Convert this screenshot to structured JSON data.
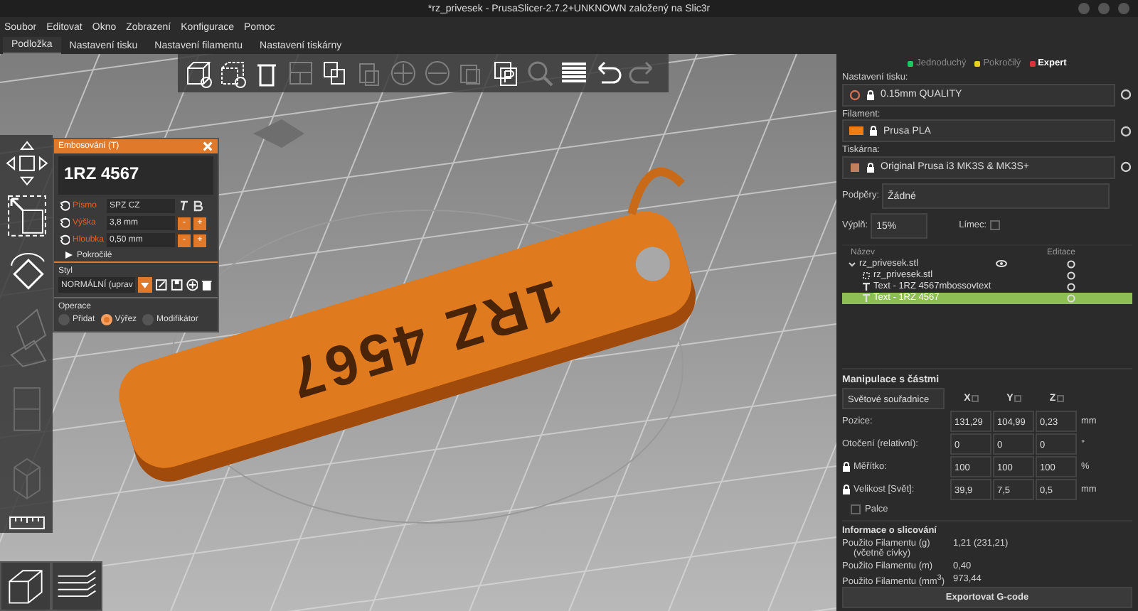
{
  "window": {
    "title": "*rz_privesek - PrusaSlicer-2.7.2+UNKNOWN založený na Slic3r"
  },
  "menu": [
    "Soubor",
    "Editovat",
    "Okno",
    "Zobrazení",
    "Konfigurace",
    "Pomoc"
  ],
  "tabs": [
    {
      "label": "Podložka",
      "selected": true
    },
    {
      "label": "Nastavení tisku",
      "selected": false
    },
    {
      "label": "Nastavení filamentu",
      "selected": false
    },
    {
      "label": "Nastavení tiskárny",
      "selected": false
    }
  ],
  "toolbar": [
    {
      "kind": "add",
      "disabled": false
    },
    {
      "kind": "delete-part",
      "disabled": false
    },
    {
      "kind": "delete",
      "disabled": false
    },
    {
      "kind": "arrange",
      "disabled": true
    },
    {
      "kind": "copy",
      "disabled": false
    },
    {
      "kind": "paste",
      "disabled": true
    },
    {
      "kind": "plus",
      "disabled": true
    },
    {
      "kind": "minus",
      "disabled": true
    },
    {
      "kind": "split",
      "disabled": true
    },
    {
      "kind": "paste-parts",
      "disabled": false
    },
    {
      "kind": "search",
      "disabled": true
    },
    {
      "kind": "layers",
      "disabled": false
    },
    {
      "kind": "undo",
      "disabled": false
    },
    {
      "kind": "redo",
      "disabled": true
    }
  ],
  "viewport": {
    "model_text": "1RZ 4567"
  },
  "emboss": {
    "title": "Embosování (T)",
    "text": "1RZ 4567",
    "fields": [
      {
        "label": "Písmo",
        "value": "SPZ CZ",
        "kind": "font"
      },
      {
        "label": "Výška",
        "value": "3,8 mm",
        "kind": "spin",
        "minus": "-",
        "plus": "+"
      },
      {
        "label": "Hloubka",
        "value": "0,50 mm",
        "kind": "spin",
        "minus": "-",
        "plus": "+"
      }
    ],
    "advanced": {
      "label": "Pokročilé",
      "expanded": false
    },
    "style_label": "Styl",
    "style_value": "NORMÁLNÍ (uprav",
    "operation_label": "Operace",
    "operations": [
      {
        "label": "Přidat",
        "selected": false
      },
      {
        "label": "Výřez",
        "selected": true
      },
      {
        "label": "Modifikátor",
        "selected": false
      }
    ]
  },
  "sidebar": {
    "modes": [
      {
        "label": "Jednoduchý",
        "color": "#22c55e",
        "selected": false
      },
      {
        "label": "Pokročilý",
        "color": "#e8d21e",
        "selected": false
      },
      {
        "label": "Expert",
        "color": "#e0303a",
        "selected": true
      }
    ],
    "presets": [
      {
        "label": "Nastavení tisku:",
        "value": "0.15mm QUALITY",
        "kind": "print"
      },
      {
        "label": "Filament:",
        "value": "Prusa PLA",
        "kind": "filament",
        "color": "#f07c14"
      },
      {
        "label": "Tiskárna:",
        "value": "Original Prusa i3 MK3S & MK3S+",
        "kind": "printer"
      }
    ],
    "supports": {
      "label": "Podpěry:",
      "value": "Žádné"
    },
    "infill": {
      "label": "Výplň:",
      "value": "15%"
    },
    "brim": {
      "label": "Límec:",
      "checked": false
    },
    "object_list": {
      "columns": [
        "Název",
        "Editace"
      ],
      "items": [
        {
          "name": "rz_privesek.stl",
          "kind": "object",
          "expanded": true,
          "selected": false,
          "children": [
            {
              "name": "rz_privesek.stl",
              "kind": "part",
              "selected": false
            },
            {
              "name": "Text - 1RZ 4567mbossovtext",
              "kind": "text",
              "selected": false
            },
            {
              "name": "Text - 1RZ 4567",
              "kind": "text",
              "selected": true
            }
          ]
        }
      ]
    },
    "manipulation": {
      "title": "Manipulace s částmi",
      "coordinates": "Světové souřadnice",
      "axes": [
        {
          "label": "X",
          "checked": false
        },
        {
          "label": "Y",
          "checked": false
        },
        {
          "label": "Z",
          "checked": false
        }
      ],
      "rows": [
        {
          "label": "Pozice:",
          "values": [
            "131,29",
            "104,99",
            "0,23"
          ],
          "unit": "mm"
        },
        {
          "label": "Otočení (relativní):",
          "values": [
            "0",
            "0",
            "0"
          ],
          "unit": "°"
        },
        {
          "label": "Měřítko:",
          "values": [
            "100",
            "100",
            "100"
          ],
          "unit": "%"
        },
        {
          "label": "Velikost [Svět]:",
          "values": [
            "39,9",
            "7,5",
            "0,5"
          ],
          "unit": "mm"
        }
      ],
      "inches": {
        "label": "Palce",
        "checked": false
      }
    },
    "slicing_info": {
      "title": "Informace o slicování",
      "rows": [
        {
          "label": "Použito Filamentu (g)",
          "note": "(včetně cívky)",
          "value": "1,21 (231,21)"
        },
        {
          "label": "Použito Filamentu (m)",
          "value": "0,40"
        },
        {
          "label": "Použito Filamentu (mm$^{3}$)",
          "value": "973,44"
        }
      ]
    },
    "export_button": "Exportovat G-code"
  }
}
